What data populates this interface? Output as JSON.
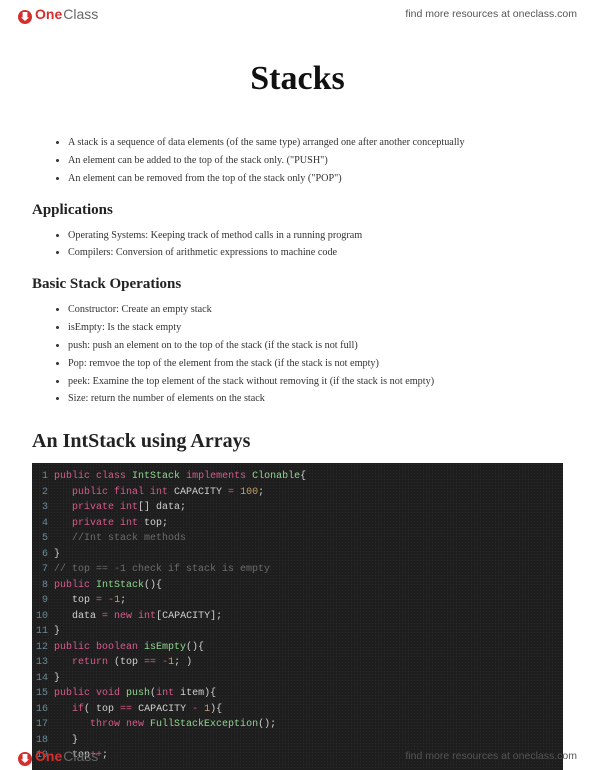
{
  "brand": {
    "one": "One",
    "class": "Class"
  },
  "resources_text": "find more resources at oneclass.com",
  "title": "Stacks",
  "intro_bullets": [
    "A stack is a sequence of data elements (of the same type) arranged one after another conceptually",
    "An element can be added to the top of the stack only. (\"PUSH\")",
    "An element can be removed from the top of the stack only (\"POP\")"
  ],
  "applications_heading": "Applications",
  "applications_bullets": [
    "Operating Systems: Keeping track of method calls in a running program",
    "Compilers: Conversion of arithmetic expressions to machine code"
  ],
  "basic_ops_heading": "Basic Stack Operations",
  "basic_ops_bullets": [
    "Constructor: Create an empty stack",
    "isEmpty: Is the stack empty",
    "push: push an element on to the top of the stack (if the stack is not full)",
    "Pop: remvoe the top of the element from the stack (if the stack is not empty)",
    "peek: Examine the top element of the stack without removing it (if the stack is not empty)",
    "Size: return the number of elements on the stack"
  ],
  "intstack_heading": "An IntStack using Arrays",
  "code": [
    {
      "n": "1",
      "tokens": [
        [
          "kw",
          "public class"
        ],
        [
          "plain",
          " "
        ],
        [
          "cls",
          "IntStack"
        ],
        [
          "plain",
          " "
        ],
        [
          "kw",
          "implements"
        ],
        [
          "plain",
          " "
        ],
        [
          "cls",
          "Clonable"
        ],
        [
          "brace",
          "{"
        ]
      ]
    },
    {
      "n": "2",
      "tokens": [
        [
          "plain",
          "   "
        ],
        [
          "kw",
          "public final int"
        ],
        [
          "plain",
          " CAPACITY "
        ],
        [
          "op",
          "="
        ],
        [
          "plain",
          " "
        ],
        [
          "num",
          "100"
        ],
        [
          "plain",
          ";"
        ]
      ]
    },
    {
      "n": "3",
      "tokens": [
        [
          "plain",
          "   "
        ],
        [
          "kw",
          "private int"
        ],
        [
          "plain",
          "[] data;"
        ]
      ]
    },
    {
      "n": "4",
      "tokens": [
        [
          "plain",
          "   "
        ],
        [
          "kw",
          "private int"
        ],
        [
          "plain",
          " top;"
        ]
      ]
    },
    {
      "n": "5",
      "tokens": [
        [
          "plain",
          "   "
        ],
        [
          "com",
          "//Int stack methods"
        ]
      ]
    },
    {
      "n": "6",
      "tokens": [
        [
          "brace",
          "}"
        ]
      ]
    },
    {
      "n": "7",
      "tokens": [
        [
          "com",
          "// top == -1 check if stack is empty"
        ]
      ]
    },
    {
      "n": "8",
      "tokens": [
        [
          "kw",
          "public"
        ],
        [
          "plain",
          " "
        ],
        [
          "cls",
          "IntStack"
        ],
        [
          "plain",
          "(){"
        ]
      ]
    },
    {
      "n": "9",
      "tokens": [
        [
          "plain",
          "   top "
        ],
        [
          "op",
          "="
        ],
        [
          "plain",
          " "
        ],
        [
          "op",
          "-"
        ],
        [
          "num",
          "1"
        ],
        [
          "plain",
          ";"
        ]
      ]
    },
    {
      "n": "10",
      "tokens": [
        [
          "plain",
          "   data "
        ],
        [
          "op",
          "="
        ],
        [
          "plain",
          " "
        ],
        [
          "kw",
          "new int"
        ],
        [
          "plain",
          "[CAPACITY];"
        ]
      ]
    },
    {
      "n": "11",
      "tokens": [
        [
          "brace",
          "}"
        ]
      ]
    },
    {
      "n": "12",
      "tokens": [
        [
          "kw",
          "public boolean"
        ],
        [
          "plain",
          " "
        ],
        [
          "cls",
          "isEmpty"
        ],
        [
          "plain",
          "(){"
        ]
      ]
    },
    {
      "n": "13",
      "tokens": [
        [
          "plain",
          "   "
        ],
        [
          "kw",
          "return"
        ],
        [
          "plain",
          " (top "
        ],
        [
          "op",
          "=="
        ],
        [
          "plain",
          " "
        ],
        [
          "op",
          "-"
        ],
        [
          "num",
          "1"
        ],
        [
          "plain",
          "; )"
        ]
      ]
    },
    {
      "n": "14",
      "tokens": [
        [
          "brace",
          "}"
        ]
      ]
    },
    {
      "n": "15",
      "tokens": [
        [
          "kw",
          "public void"
        ],
        [
          "plain",
          " "
        ],
        [
          "cls",
          "push"
        ],
        [
          "plain",
          "("
        ],
        [
          "kw",
          "int"
        ],
        [
          "plain",
          " item){"
        ]
      ]
    },
    {
      "n": "16",
      "tokens": [
        [
          "plain",
          "   "
        ],
        [
          "kw",
          "if"
        ],
        [
          "plain",
          "( top "
        ],
        [
          "op",
          "=="
        ],
        [
          "plain",
          " CAPACITY "
        ],
        [
          "op",
          "-"
        ],
        [
          "plain",
          " "
        ],
        [
          "num",
          "1"
        ],
        [
          "plain",
          "){"
        ]
      ]
    },
    {
      "n": "17",
      "tokens": [
        [
          "plain",
          "      "
        ],
        [
          "kw",
          "throw new"
        ],
        [
          "plain",
          " "
        ],
        [
          "cls",
          "FullStackException"
        ],
        [
          "plain",
          "();"
        ]
      ]
    },
    {
      "n": "18",
      "tokens": [
        [
          "plain",
          "   }"
        ]
      ]
    },
    {
      "n": "19",
      "tokens": [
        [
          "plain",
          "   top"
        ],
        [
          "op",
          "++"
        ],
        [
          "plain",
          ";"
        ]
      ]
    }
  ]
}
